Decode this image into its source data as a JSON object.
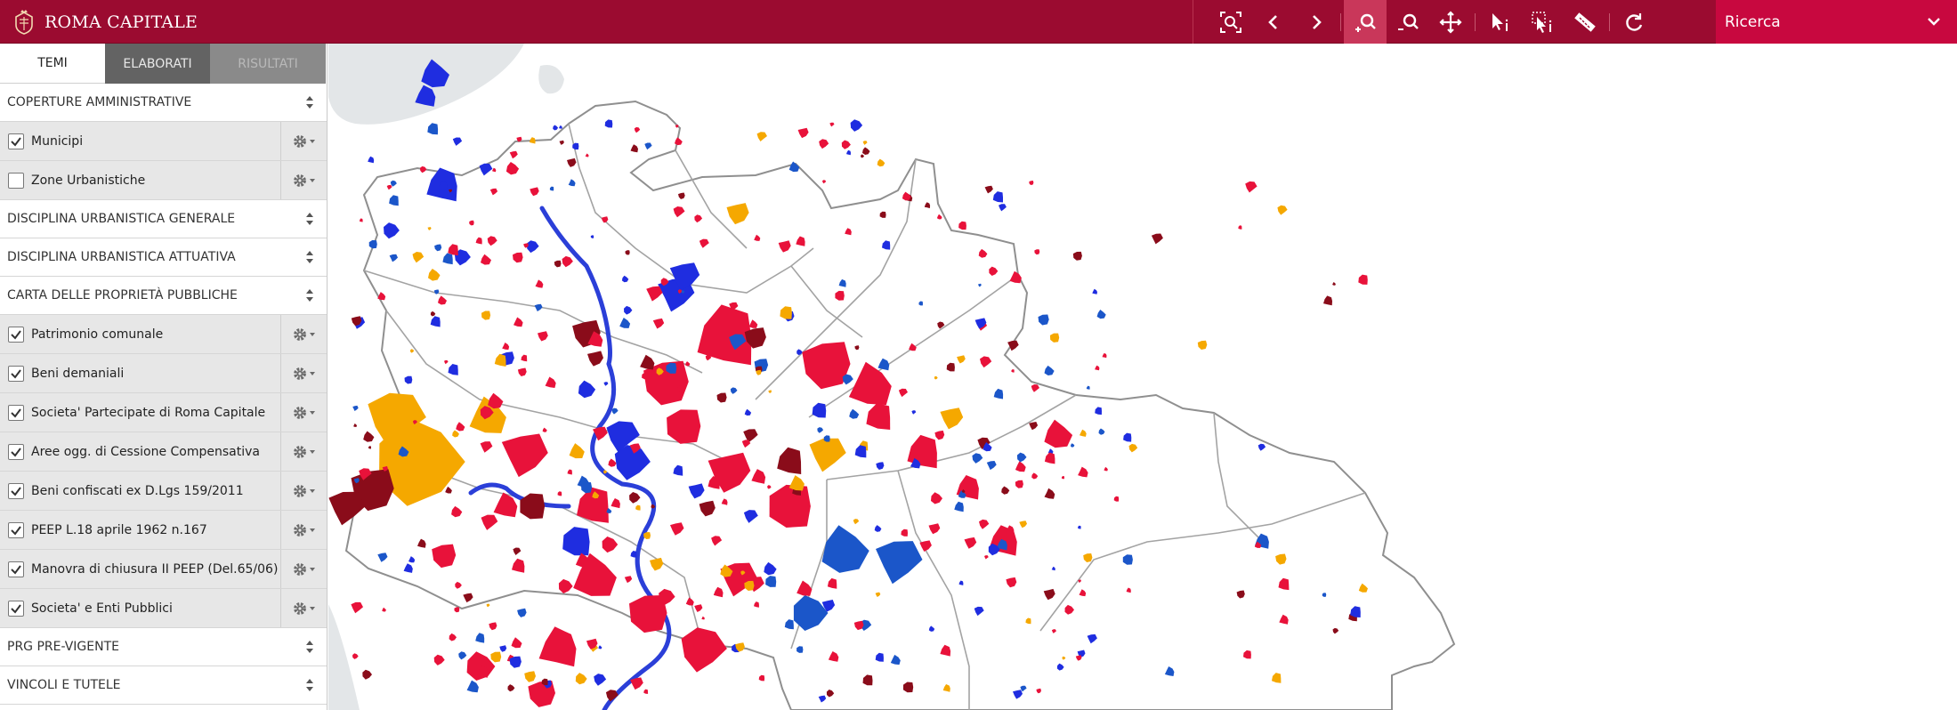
{
  "header": {
    "brand_name": "ROMA CAPITALE",
    "brand_color": "#9b0b30",
    "toolbar": [
      {
        "name": "zoom-extent-icon",
        "active": false
      },
      {
        "name": "previous-view-icon",
        "active": false
      },
      {
        "name": "next-view-icon",
        "active": false
      },
      {
        "name": "zoom-in-icon",
        "active": true
      },
      {
        "name": "zoom-out-icon",
        "active": false
      },
      {
        "name": "pan-icon",
        "active": false
      },
      {
        "name": "identify-icon",
        "active": false
      },
      {
        "name": "select-info-icon",
        "active": false
      },
      {
        "name": "measure-icon",
        "active": false
      },
      {
        "name": "refresh-icon",
        "active": false
      }
    ],
    "search": {
      "label": "Ricerca"
    }
  },
  "tabs": [
    {
      "label": "TEMI",
      "state": "active"
    },
    {
      "label": "ELABORATI",
      "state": "normal"
    },
    {
      "label": "RISULTATI",
      "state": "disabled"
    }
  ],
  "layers": {
    "coperture": {
      "title": "COPERTURE AMMINISTRATIVE",
      "items": [
        {
          "label": "Municipi",
          "checked": true
        },
        {
          "label": "Zone Urbanistiche",
          "checked": false
        }
      ]
    },
    "disciplina_generale": {
      "title": "DISCIPLINA URBANISTICA GENERALE"
    },
    "disciplina_attuativa": {
      "title": "DISCIPLINA URBANISTICA ATTUATIVA"
    },
    "carta": {
      "title": "CARTA DELLE PROPRIETÀ PUBBLICHE",
      "items": [
        {
          "label": "Patrimonio comunale",
          "checked": true
        },
        {
          "label": "Beni demaniali",
          "checked": true
        },
        {
          "label": "Societa' Partecipate di Roma Capitale",
          "checked": true
        },
        {
          "label": "Aree ogg. di Cessione Compensativa",
          "checked": true
        },
        {
          "label": "Beni confiscati ex D.Lgs 159/2011",
          "checked": true
        },
        {
          "label": "PEEP L.18 aprile 1962 n.167",
          "checked": true
        },
        {
          "label": "Manovra di chiusura II PEEP (Del.65/06)",
          "checked": true
        },
        {
          "label": "Societa' e Enti Pubblici",
          "checked": true
        }
      ]
    },
    "prg": {
      "title": "PRG PRE-VIGENTE"
    },
    "vincoli": {
      "title": "VINCOLI E TUTELE"
    }
  },
  "map": {
    "colors": {
      "patrimonio": "#e8123a",
      "beni_demaniali": "#1f2de0",
      "societa": "#8a0c1a",
      "cessione": "#f5a800",
      "enti": "#1b56c9",
      "boundary": "#8f8f8f",
      "sea": "#e3e6e8"
    }
  }
}
